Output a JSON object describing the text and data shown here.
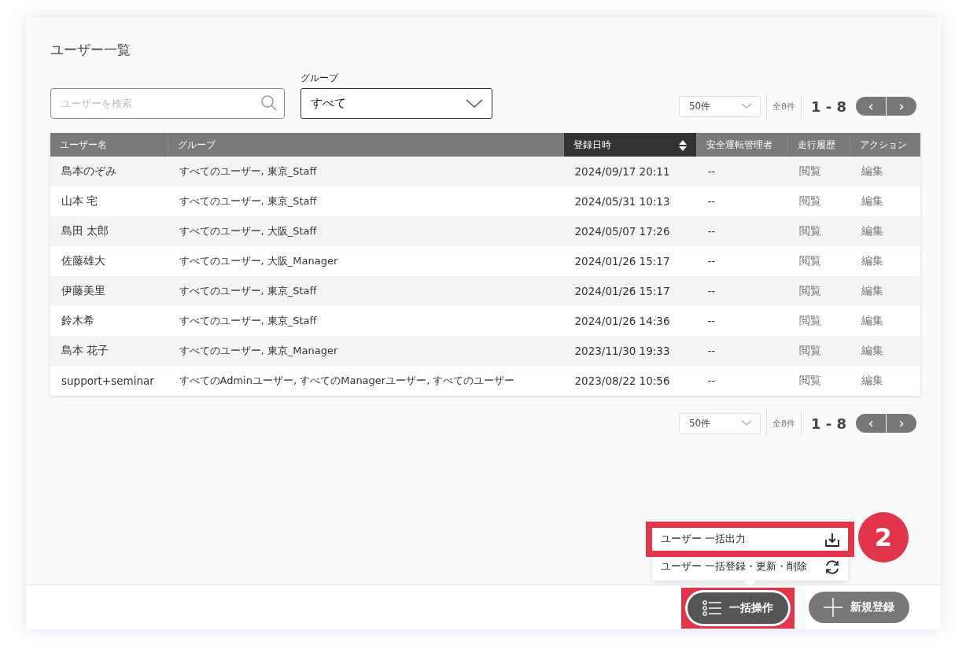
{
  "page_title": "ユーザー一覧",
  "search": {
    "placeholder": "ユーザーを検索"
  },
  "group_filter": {
    "label": "グループ",
    "value": "すべて"
  },
  "pagers": [
    {
      "per_page": "50件",
      "total": "全8件",
      "range": "1 - 8",
      "prev": "‹",
      "next": "›"
    },
    {
      "per_page": "50件",
      "total": "全8件",
      "range": "1 - 8",
      "prev": "‹",
      "next": "›"
    }
  ],
  "table": {
    "columns": [
      {
        "label": "ユーザー名",
        "sorted": false
      },
      {
        "label": "グループ",
        "sorted": false
      },
      {
        "label": "登録日時",
        "sorted": true
      },
      {
        "label": "安全運転管理者",
        "sorted": false
      },
      {
        "label": "走行履歴",
        "sorted": false
      },
      {
        "label": "アクション",
        "sorted": false
      }
    ],
    "rows": [
      [
        "島本のぞみ",
        "すべてのユーザー, 東京_Staff",
        "2024/09/17 20:11",
        "--",
        "閲覧",
        "編集"
      ],
      [
        "山本 宅",
        "すべてのユーザー, 東京_Staff",
        "2024/05/31 10:13",
        "--",
        "閲覧",
        "編集"
      ],
      [
        "島田 太郎",
        "すべてのユーザー, 大阪_Staff",
        "2024/05/07 17:26",
        "--",
        "閲覧",
        "編集"
      ],
      [
        "佐藤雄大",
        "すべてのユーザー, 大阪_Manager",
        "2024/01/26 15:17",
        "--",
        "閲覧",
        "編集"
      ],
      [
        "伊藤美里",
        "すべてのユーザー, 東京_Staff",
        "2024/01/26 15:17",
        "--",
        "閲覧",
        "編集"
      ],
      [
        "鈴木希",
        "すべてのユーザー, 東京_Staff",
        "2024/01/26 14:36",
        "--",
        "閲覧",
        "編集"
      ],
      [
        "島本 花子",
        "すべてのユーザー, 東京_Manager",
        "2023/11/30 19:33",
        "--",
        "閲覧",
        "編集"
      ],
      [
        "support+seminar",
        "すべてのAdminユーザー, すべてのManagerユーザー, すべてのユーザー",
        "2023/08/22 10:56",
        "--",
        "閲覧",
        "編集"
      ]
    ]
  },
  "bulk_menu": {
    "items": [
      {
        "label": "ユーザー 一括出力",
        "kind": "download",
        "highlighted": true
      },
      {
        "label": "ユーザー 一括登録・更新・削除",
        "kind": "refresh",
        "highlighted": false
      }
    ]
  },
  "step_badge": "2",
  "footer_buttons": [
    {
      "label": "一括操作",
      "kind": "list",
      "highlighted": true
    },
    {
      "label": "新規登録",
      "kind": "plus",
      "highlighted": false
    }
  ]
}
